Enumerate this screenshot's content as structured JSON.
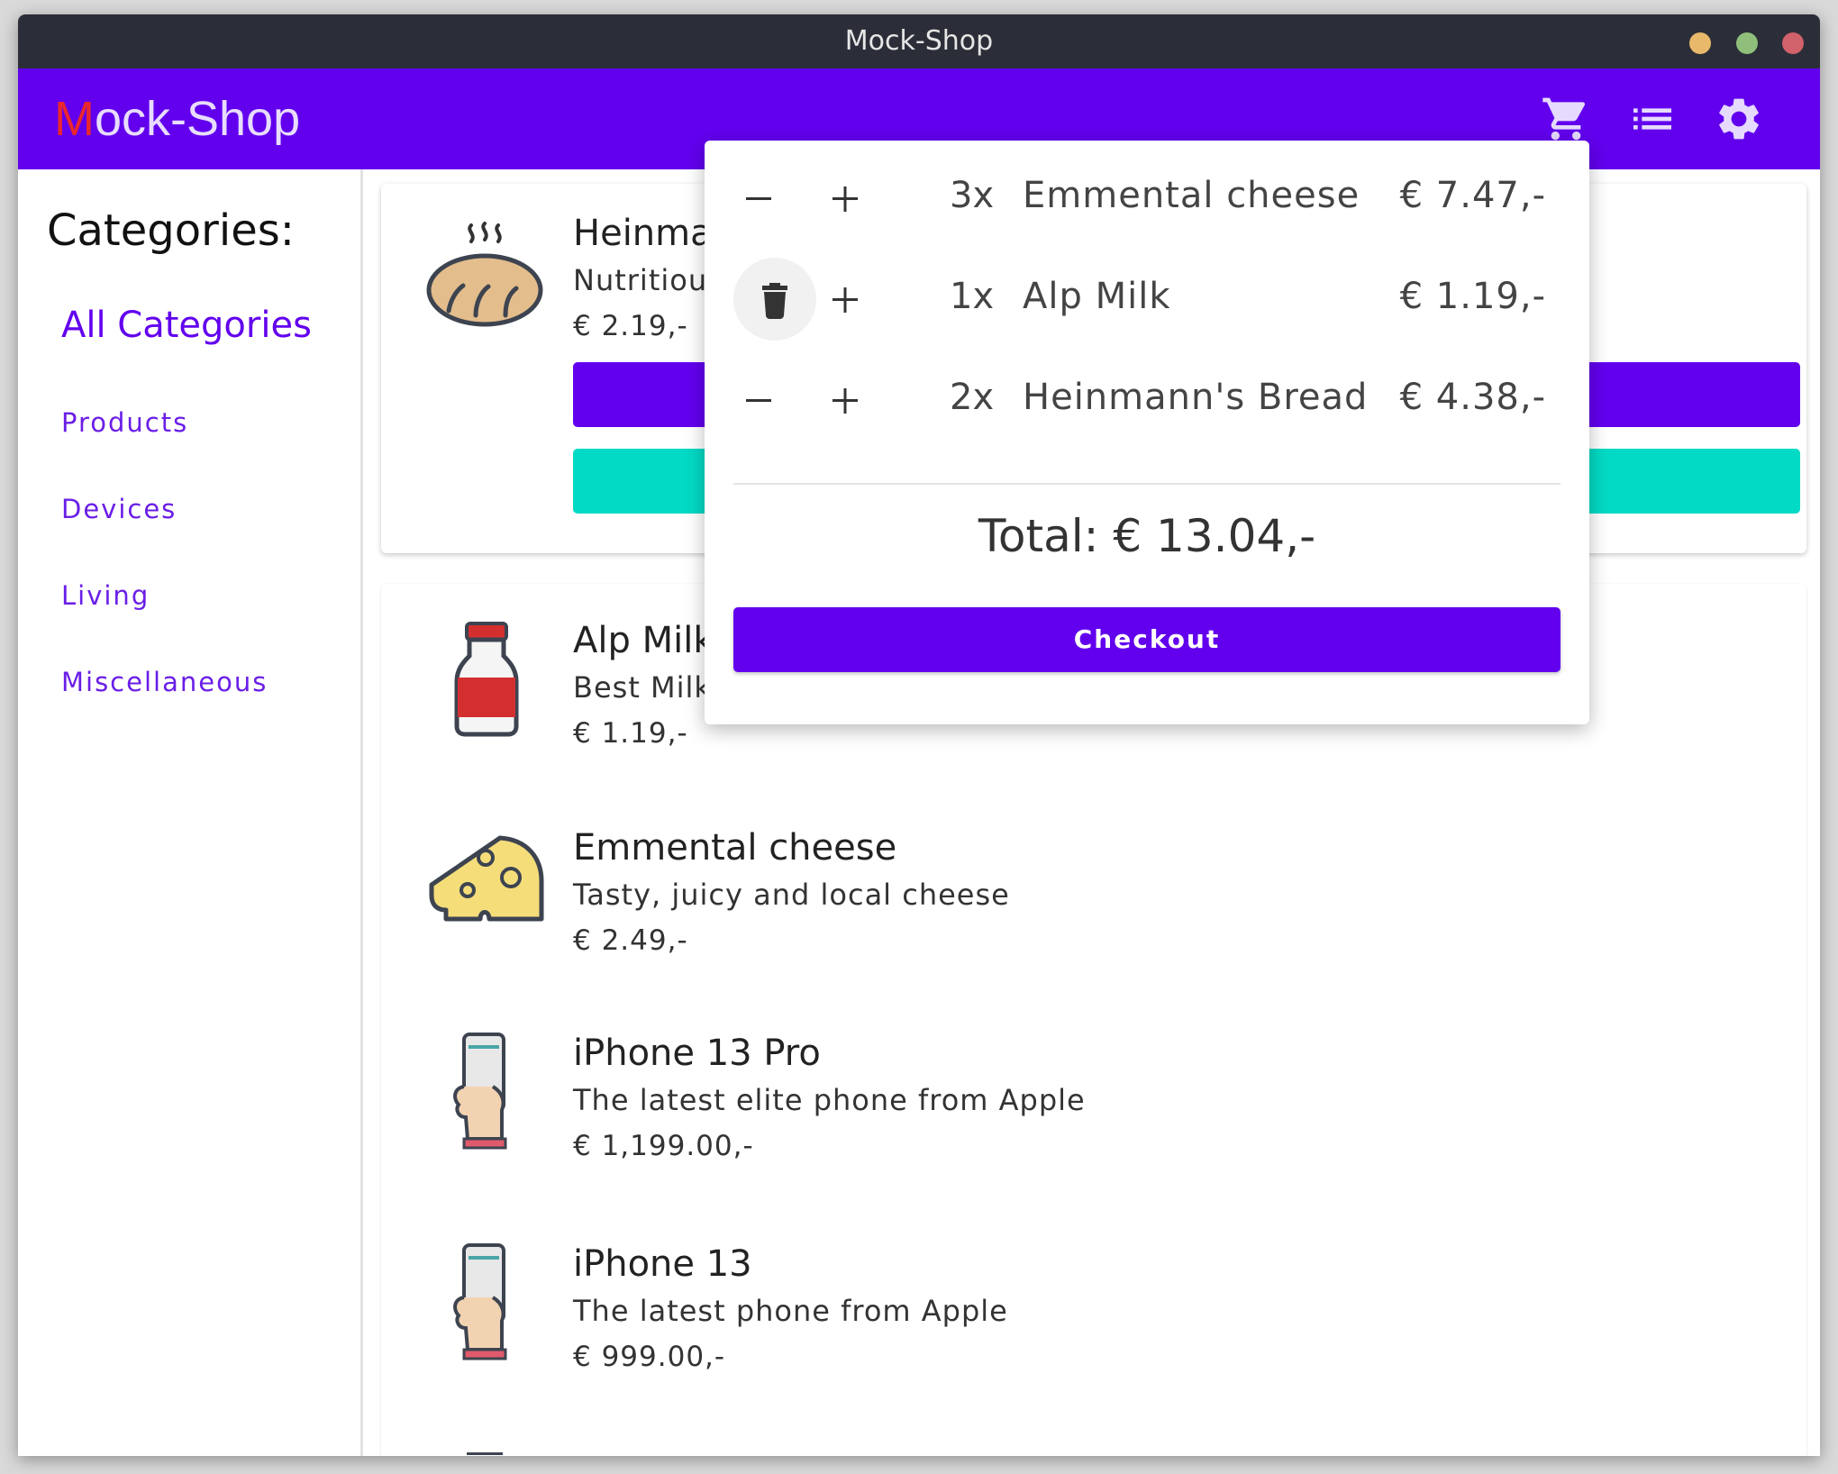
{
  "window": {
    "title": "Mock-Shop"
  },
  "appbar": {
    "logo_first": "M",
    "logo_rest": "ock-Shop",
    "icons": [
      "cart-icon",
      "list-icon",
      "settings-icon"
    ],
    "color": "#6200ee"
  },
  "sidebar": {
    "heading": "Categories:",
    "all": "All Categories",
    "items": [
      "Products",
      "Devices",
      "Living",
      "Miscellaneous"
    ]
  },
  "products": [
    {
      "name": "Heinmar",
      "desc": "Nutritious",
      "price": "€ 2.19,-",
      "icon": "bread-icon"
    },
    {
      "name": "Alp Milk",
      "desc": "Best Milk i",
      "price": "€ 1.19,-",
      "icon": "milk-bottle-icon"
    },
    {
      "name": "Emmental cheese",
      "desc": "Tasty, juicy and local cheese",
      "price": "€ 2.49,-",
      "icon": "cheese-icon"
    },
    {
      "name": "iPhone 13 Pro",
      "desc": "The latest elite phone from Apple",
      "price": "€ 1,199.00,-",
      "icon": "phone-in-hand-icon"
    },
    {
      "name": "iPhone 13",
      "desc": "The latest phone from Apple",
      "price": "€ 999.00,-",
      "icon": "phone-in-hand-icon"
    }
  ],
  "cart": {
    "items": [
      {
        "qty": "3x",
        "name": "Emmental cheese",
        "price": "€ 7.47,-",
        "decrease": "minus-icon",
        "increase": "plus-icon"
      },
      {
        "qty": "1x",
        "name": "Alp Milk",
        "price": "€ 1.19,-",
        "decrease": "trash-icon",
        "increase": "plus-icon"
      },
      {
        "qty": "2x",
        "name": "Heinmann's Bread",
        "price": "€ 4.38,-",
        "decrease": "minus-icon",
        "increase": "plus-icon"
      }
    ],
    "total": "Total: € 13.04,-",
    "checkout": "Checkout"
  }
}
